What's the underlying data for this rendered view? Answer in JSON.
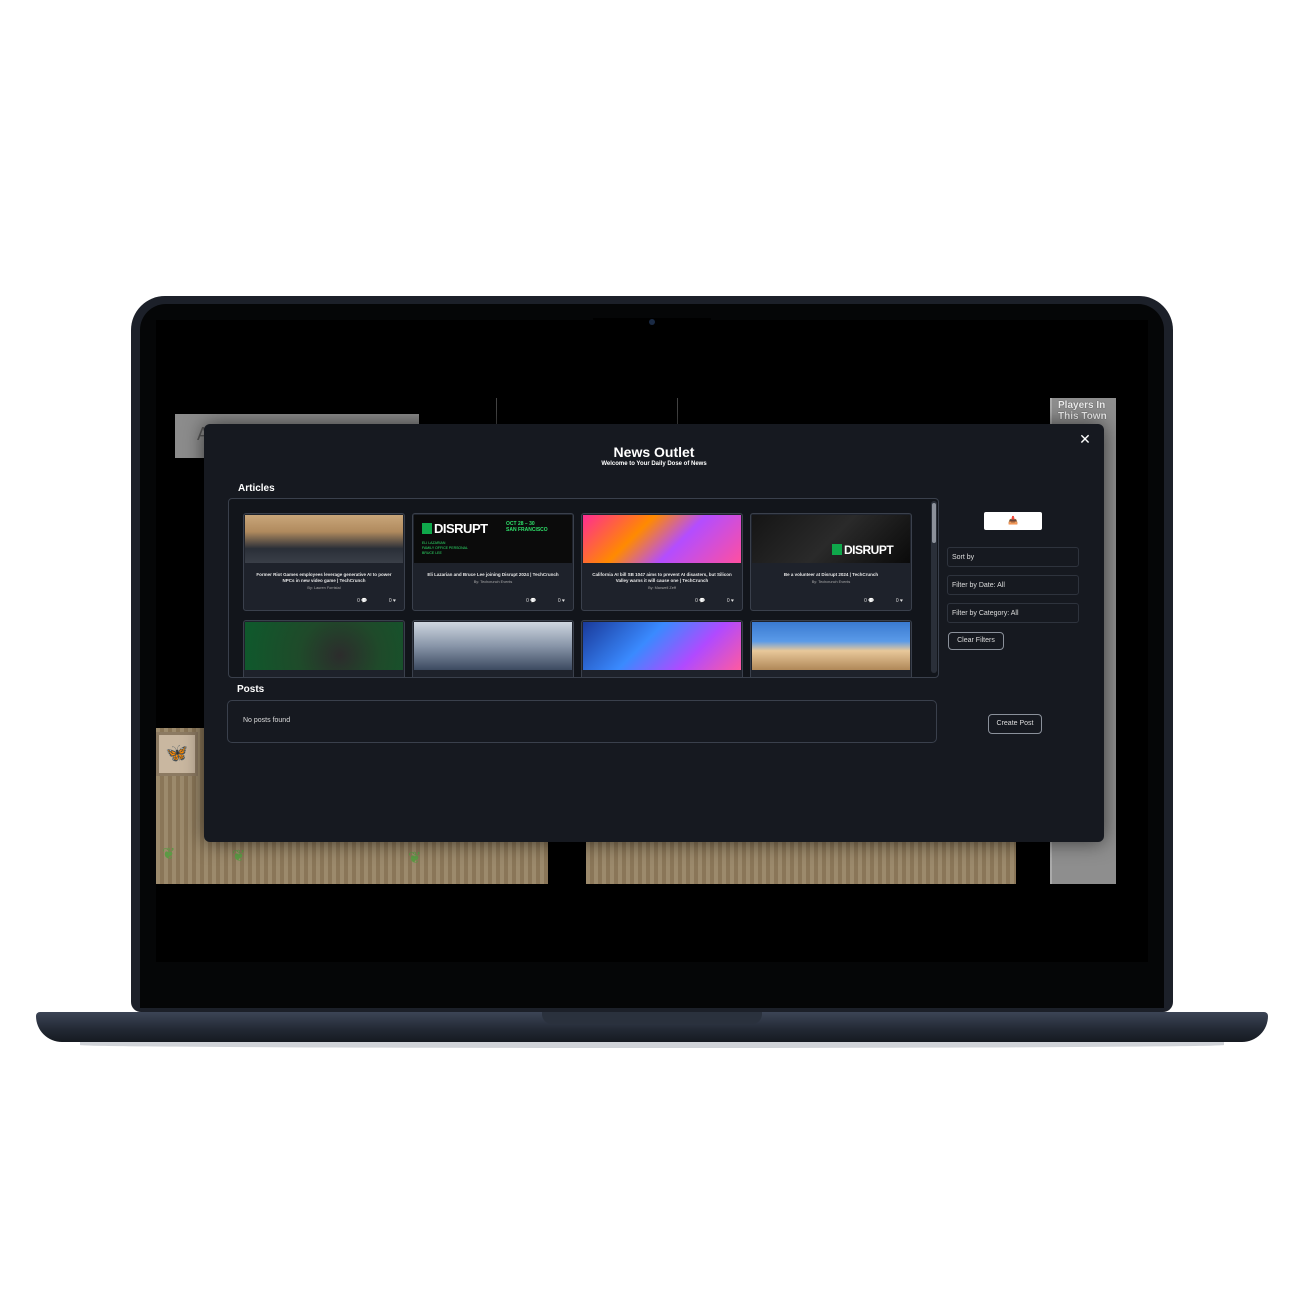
{
  "game": {
    "left_panel_text": "A",
    "players_panel_title": "Players In This Town"
  },
  "modal": {
    "title": "News Outlet",
    "subtitle": "Welcome to Your Daily Dose of News",
    "close_label": "✕",
    "articles_label": "Articles",
    "posts_label": "Posts",
    "articles": [
      {
        "title": "Former Riot Games employees leverage generative AI to power NPCs in new video game | TechCrunch",
        "author": "By: Lauren Forristal",
        "comments": "0",
        "likes": "0"
      },
      {
        "title": "Eli Lazarian and Bruce Lee joining Disrupt 2024 | TechCrunch",
        "author": "By: Techcrunch Events",
        "comments": "0",
        "likes": "0"
      },
      {
        "title": "California AI bill SB 1047 aims to prevent AI disasters, but Silicon Valley warns it will cause one | TechCrunch",
        "author": "By: Maxwell Zeff",
        "comments": "0",
        "likes": "0"
      },
      {
        "title": "Be a volunteer at Disrupt 2024 | TechCrunch",
        "author": "By: Techcrunch Events",
        "comments": "0",
        "likes": "0"
      }
    ],
    "disrupt_banner": {
      "logo": "DISRUPT",
      "date_line1": "OCT 28 – 30",
      "date_line2": "SAN FRANCISCO",
      "small_line1": "ELI LAZARIAN",
      "small_line2": "FAMILY OFFICE PERSONAL",
      "small_line3": "BRUCE LEE"
    },
    "disrupt_banner_2": {
      "logo": "DISRUPT"
    },
    "side": {
      "icon_button": "📥",
      "sort_by": "Sort by",
      "filter_date": "Filter by Date: All",
      "filter_category": "Filter by Category: All",
      "clear_filters": "Clear Filters",
      "create_post": "Create Post"
    },
    "posts_empty": "No posts found"
  },
  "colors": {
    "modal_bg": "#161920",
    "card_bg": "#1e222b",
    "border": "#3a404c",
    "disrupt_green": "#0fa84b"
  }
}
